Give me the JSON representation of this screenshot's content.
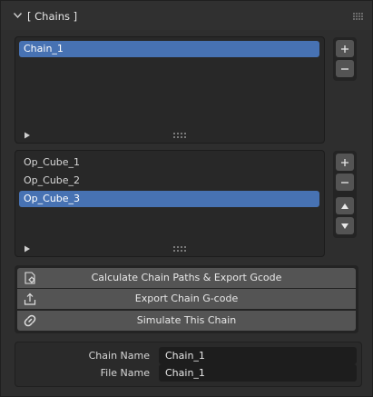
{
  "panel": {
    "title": "[ Chains ]"
  },
  "chains_list": {
    "items": [
      {
        "label": "Chain_1",
        "selected": true
      }
    ]
  },
  "operations_list": {
    "items": [
      {
        "label": "Op_Cube_1",
        "selected": false
      },
      {
        "label": "Op_Cube_2",
        "selected": false
      },
      {
        "label": "Op_Cube_3",
        "selected": true
      }
    ]
  },
  "side_buttons": {
    "add": "+",
    "remove": "−"
  },
  "operators": {
    "calculate": "Calculate Chain Paths & Export Gcode",
    "export": "Export Chain G-code",
    "simulate": "Simulate This Chain"
  },
  "properties": {
    "chain_name_label": "Chain Name",
    "chain_name_value": "Chain_1",
    "file_name_label": "File Name",
    "file_name_value": "Chain_1"
  },
  "colors": {
    "selection": "#4772b3",
    "button": "#545454",
    "panel_bg": "#2e2e2e"
  }
}
